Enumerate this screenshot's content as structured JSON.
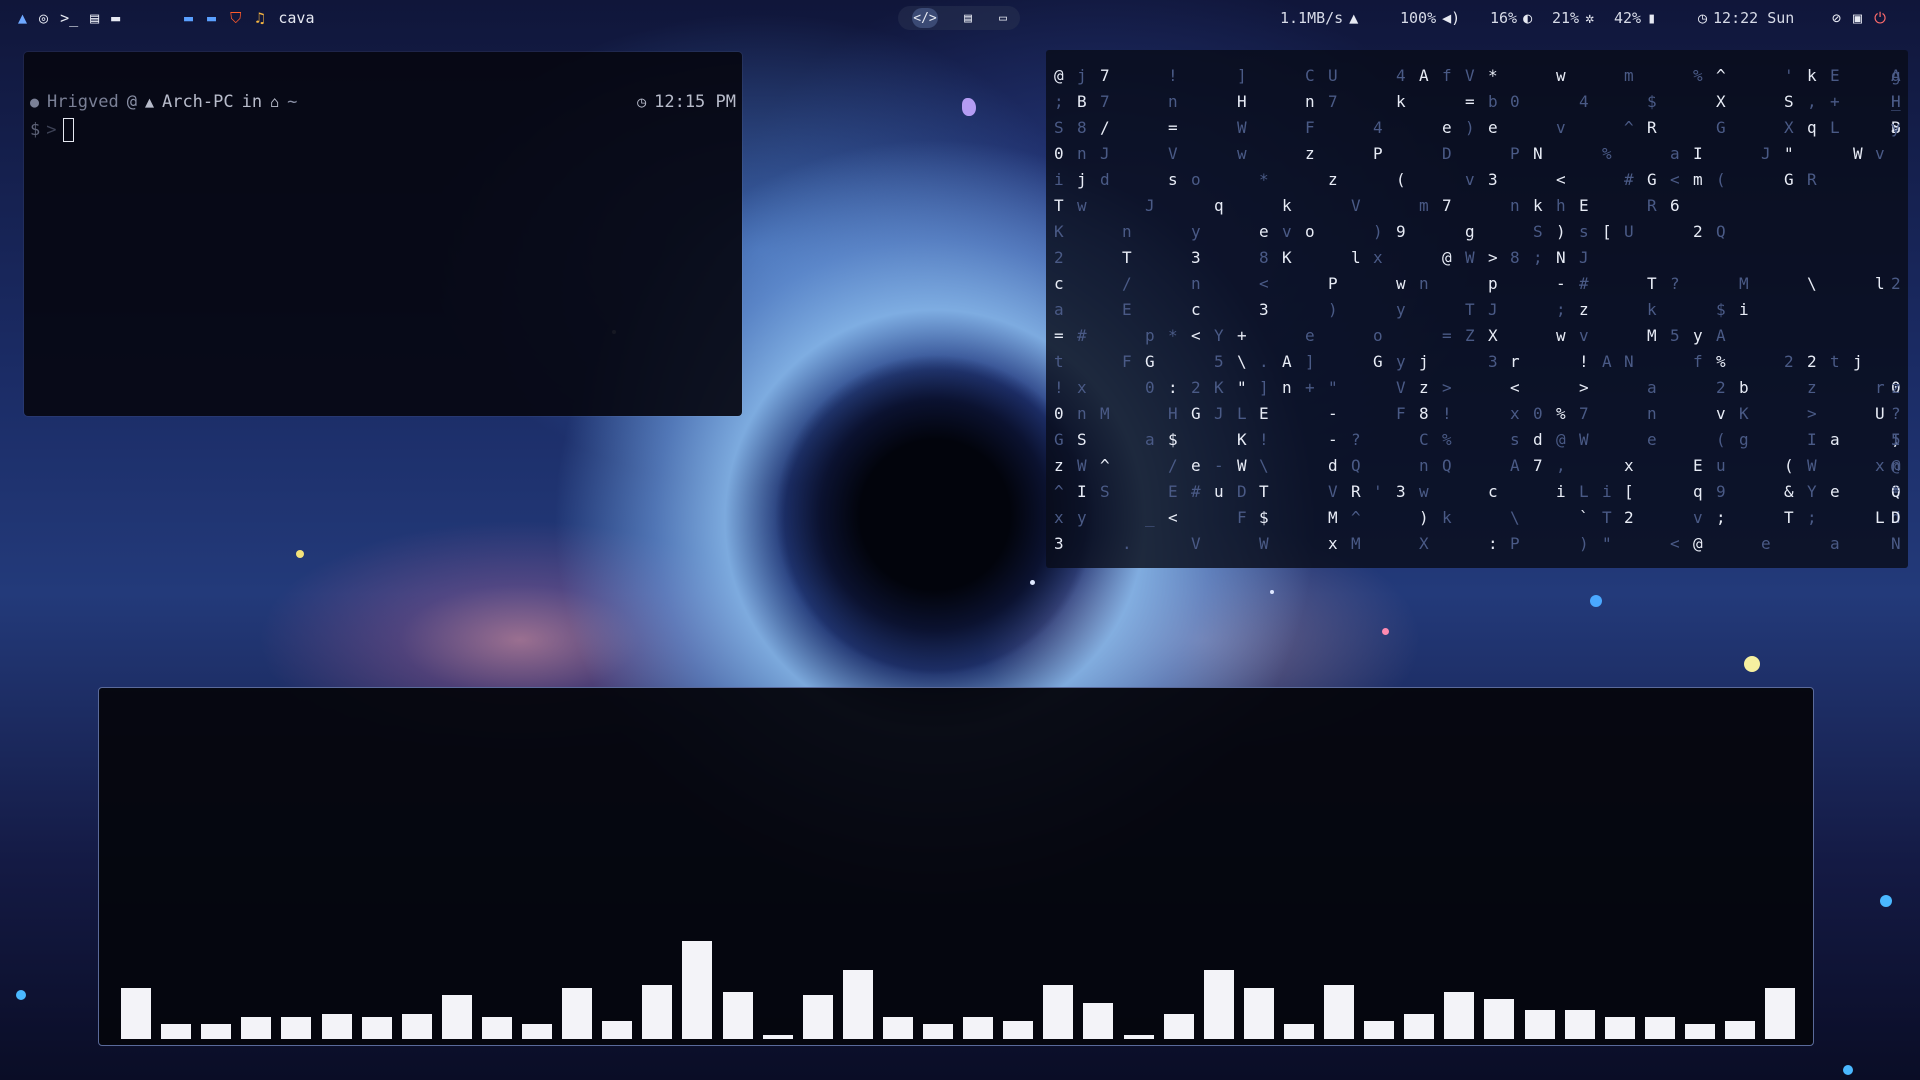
{
  "topbar": {
    "left_icons": [
      "arch-logo-icon",
      "github-icon",
      "terminal-icon",
      "calendar-icon",
      "folder-icon"
    ],
    "window_icons": [
      "folder-blue-icon",
      "folder-blue-icon",
      "brave-icon",
      "cava-icon"
    ],
    "active_window_title": "cava",
    "workspaces": [
      {
        "icon": "code-icon",
        "active": true
      },
      {
        "icon": "window-icon",
        "active": false
      },
      {
        "icon": "folder-icon",
        "active": false
      }
    ],
    "net_speed": "1.1MB/s",
    "volume": "100%",
    "brightness": "16%",
    "cpu": "21%",
    "battery": "42%",
    "clock": "12:22 Sun",
    "accent": "#6ea8ff"
  },
  "terminal": {
    "user": "Hrigved",
    "at": "@",
    "host": "Arch-PC",
    "in_word": "in",
    "path": "~",
    "time": "12:15 PM",
    "prompt_symbol": "$",
    "prompt_arrow": ">"
  },
  "matrix": {
    "rows": [
      "@j7 ! ] CU 4AfV* w m %^ 'kE Ag",
      ";B7 n H n7 k =b0 4 $ X S,+ H H_",
      "S8/ = W F 4 e)e v ^R G XqL B >y",
      "0nJ V w z P D PN % aI J\" Wv",
      "ijd so * z ( v3 < #G<m( GR",
      "Tw J q k V m7 nkhE R6",
      "K n y evo )9 g S)s[U 2Q",
      "2 T 3 8K lx @W>8;NJ",
      "c / n < P wn p -# T? M \\ l2",
      "a E c 3 ) y TJ ;z k $i",
      "=# p*<Y+ e o =ZX wv M5yA",
      "t FG 5\\.A] Gyj 3r !AN f% 22tj",
      "!x 0:2K\"]n+\" Vz> < > a 2b z r0z",
      "0nM HGJLE - F8! x0%7 n vK > U?",
      "GS a$ K! -? C% sd@W e (g Ia 5,I",
      "zW^ /e-W\\ dQ nQ A7, x Eu (W x@ n",
      "^IS E#uDT VR'3w c iLi[ q9 &Ye Q eQ*",
      "xy _< F$ M^ )k \\ `T2 v; T; Ld J D",
      "3 . V W xM X :P )\" <@ e a N"
    ]
  },
  "cava": {
    "bars": [
      14,
      4,
      4,
      6,
      6,
      7,
      6,
      7,
      12,
      6,
      4,
      14,
      5,
      15,
      27,
      13,
      1,
      12,
      19,
      6,
      4,
      6,
      5,
      15,
      10,
      1,
      7,
      19,
      14,
      4,
      15,
      5,
      7,
      13,
      11,
      8,
      8,
      6,
      6,
      4,
      5,
      14
    ]
  }
}
